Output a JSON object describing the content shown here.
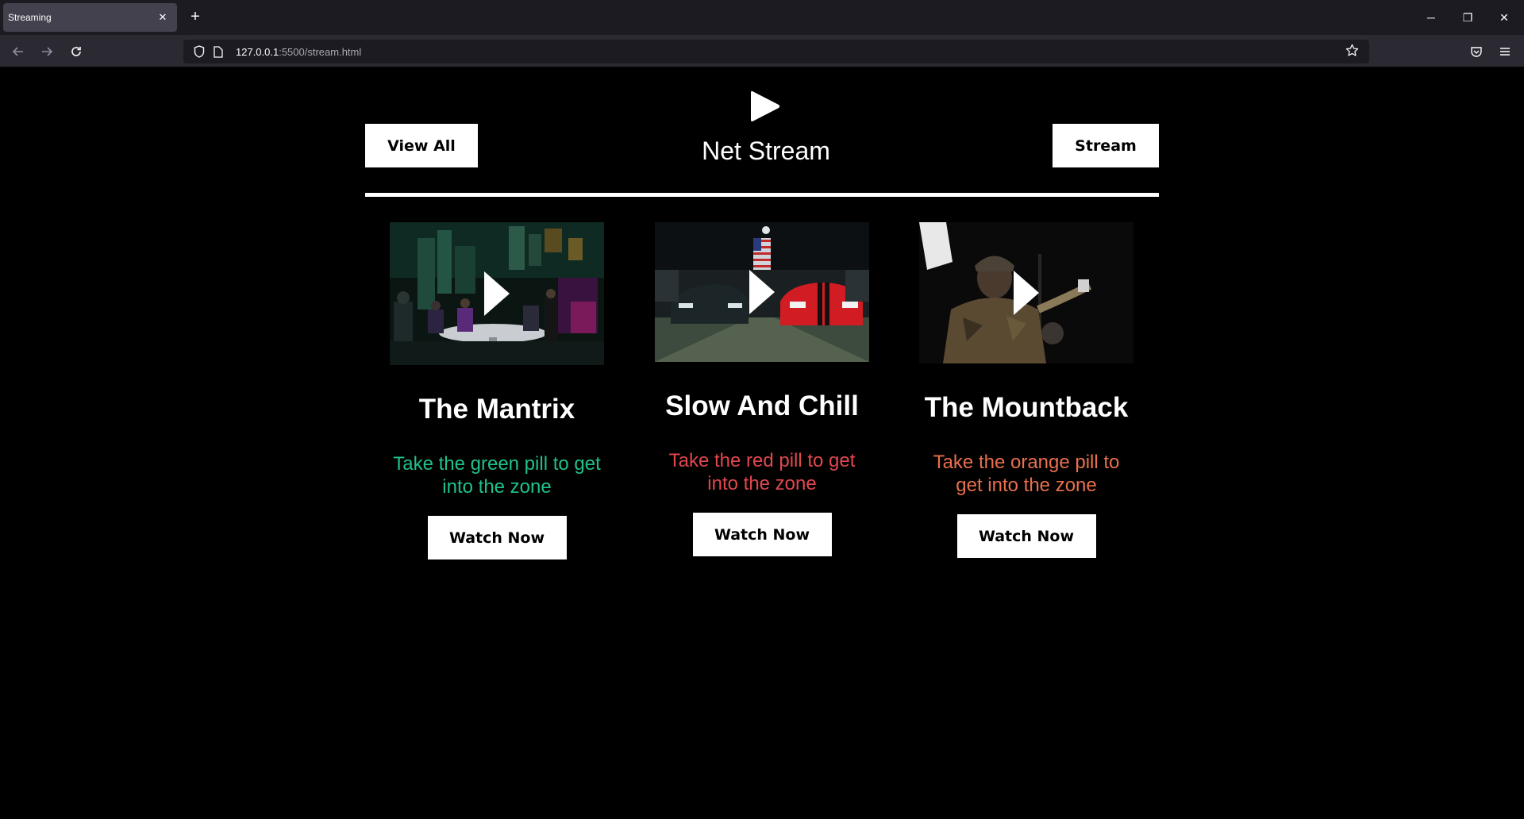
{
  "browser": {
    "tab_title": "Streaming",
    "tab_close": "✕",
    "new_tab": "+",
    "url_host": "127.0.0.1",
    "url_path": ":5500/stream.html",
    "window_controls": {
      "minimize": "─",
      "restore": "❐",
      "close": "✕"
    },
    "icons": [
      "back-arrow-icon",
      "forward-arrow-icon",
      "reload-icon",
      "shield-icon",
      "page-icon",
      "star-icon",
      "pocket-icon",
      "menu-icon"
    ]
  },
  "header": {
    "left_button": "View All",
    "title": "Net Stream",
    "right_button": "Stream"
  },
  "colors": {
    "background": "#000000",
    "green": "#1ec18a",
    "red": "#e0474e",
    "orange": "#e8704e"
  },
  "cards": [
    {
      "title": "The Mantrix",
      "description": "Take the green pill to get into the zone",
      "button": "Watch Now"
    },
    {
      "title": "Slow And Chill",
      "description": "Take the red pill to get into the zone",
      "button": "Watch Now"
    },
    {
      "title": "The Mountback",
      "description": "Take the orange pill to get into the zone",
      "button": "Watch Now"
    }
  ]
}
